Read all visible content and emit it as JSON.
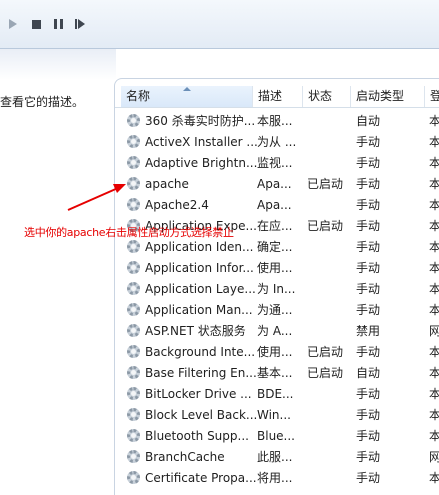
{
  "toolbar": {
    "buttons": [
      {
        "name": "start-service-button",
        "icon": "play-icon"
      },
      {
        "name": "stop-service-button",
        "icon": "stop-icon"
      },
      {
        "name": "pause-service-button",
        "icon": "pause-icon"
      },
      {
        "name": "restart-service-button",
        "icon": "restart-icon"
      }
    ]
  },
  "left_pane": {
    "description_text": "查看它的描述。"
  },
  "columns": {
    "name": "名称",
    "description": "描述",
    "status": "状态",
    "startup_type": "启动类型",
    "logon_as": "登"
  },
  "services": [
    {
      "name": "360 杀毒实时防护...",
      "description": "本服...",
      "status": "",
      "startup": "自动",
      "logon": "本"
    },
    {
      "name": "ActiveX Installer ...",
      "description": "为从 ...",
      "status": "",
      "startup": "手动",
      "logon": "本"
    },
    {
      "name": "Adaptive Brightn...",
      "description": "监视...",
      "status": "",
      "startup": "手动",
      "logon": "本"
    },
    {
      "name": "apache",
      "description": "Apa...",
      "status": "已启动",
      "startup": "手动",
      "logon": "本"
    },
    {
      "name": "Apache2.4",
      "description": "Apa...",
      "status": "",
      "startup": "手动",
      "logon": "本"
    },
    {
      "name": "Application Expe...",
      "description": "在应...",
      "status": "已启动",
      "startup": "手动",
      "logon": "本"
    },
    {
      "name": "Application Iden...",
      "description": "确定...",
      "status": "",
      "startup": "手动",
      "logon": "本"
    },
    {
      "name": "Application Infor...",
      "description": "使用...",
      "status": "",
      "startup": "手动",
      "logon": "本"
    },
    {
      "name": "Application Laye...",
      "description": "为 In...",
      "status": "",
      "startup": "手动",
      "logon": "本"
    },
    {
      "name": "Application Man...",
      "description": "为通...",
      "status": "",
      "startup": "手动",
      "logon": "本"
    },
    {
      "name": "ASP.NET 状态服务",
      "description": "为 A...",
      "status": "",
      "startup": "禁用",
      "logon": "网"
    },
    {
      "name": "Background Inte...",
      "description": "使用...",
      "status": "已启动",
      "startup": "手动",
      "logon": "本"
    },
    {
      "name": "Base Filtering En...",
      "description": "基本...",
      "status": "已启动",
      "startup": "自动",
      "logon": "本"
    },
    {
      "name": "BitLocker Drive ...",
      "description": "BDE...",
      "status": "",
      "startup": "手动",
      "logon": "本"
    },
    {
      "name": "Block Level Back...",
      "description": "Win...",
      "status": "",
      "startup": "手动",
      "logon": "本"
    },
    {
      "name": "Bluetooth Supp...",
      "description": "Blue...",
      "status": "",
      "startup": "手动",
      "logon": "本"
    },
    {
      "name": "BranchCache",
      "description": "此服...",
      "status": "",
      "startup": "手动",
      "logon": "网"
    },
    {
      "name": "Certificate Propa...",
      "description": "将用...",
      "status": "",
      "startup": "手动",
      "logon": "本"
    },
    {
      "name": "",
      "description": "",
      "status": "",
      "startup": "",
      "logon": ""
    }
  ],
  "annotation": {
    "text": "选中你的apache右击属性启动方式选择禁止",
    "color": "#e60000"
  }
}
